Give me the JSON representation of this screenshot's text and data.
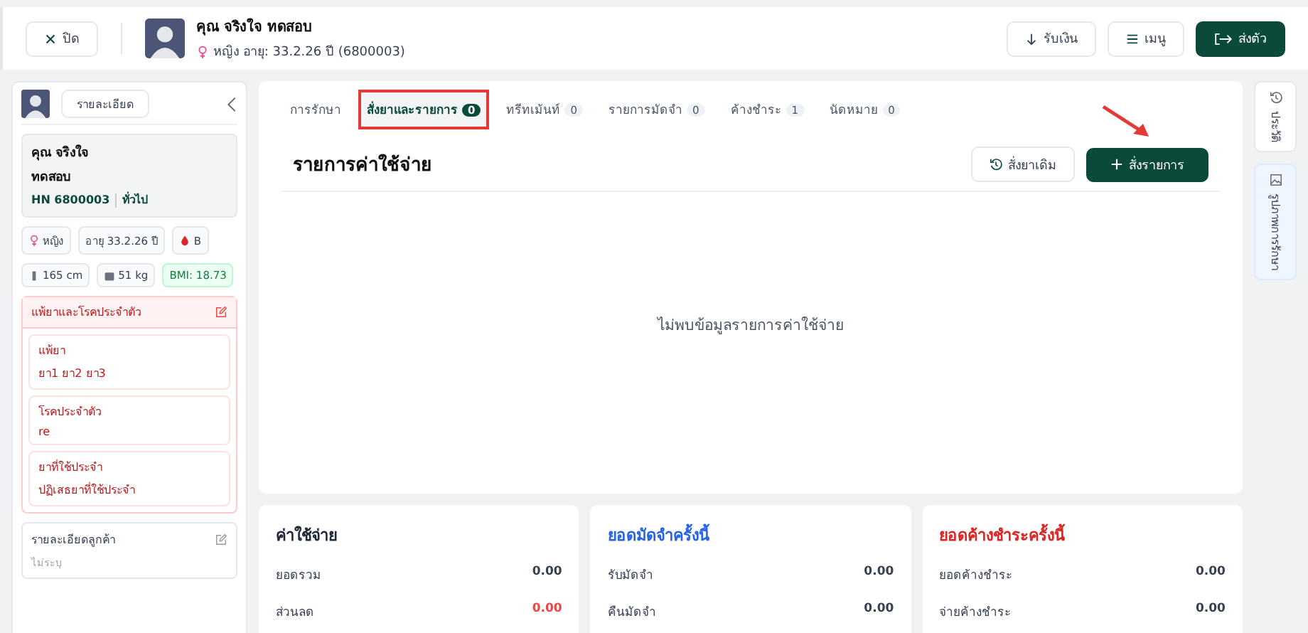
{
  "header": {
    "close_button": "ปิด",
    "patient_name": "คุณ จริงใจ ทดสอบ",
    "patient_meta": "หญิง  อายุ: 33.2.26 ปี  (6800003)",
    "buttons": [
      {
        "kind": "receive",
        "label": "รับเงิน"
      },
      {
        "kind": "menu",
        "label": "เมนู"
      },
      {
        "kind": "send",
        "label": "ส่งตัว"
      }
    ]
  },
  "sidebar": {
    "details_button": "รายละเอียด",
    "name_line1": "คุณ จริงใจ",
    "name_line2": "ทดสอบ",
    "hn": "HN 6800003",
    "group": "ทั่วไป",
    "chips": [
      {
        "kind": "gender",
        "label": "หญิง"
      },
      {
        "kind": "plain",
        "label": "อายุ 33.2.26 ปี"
      },
      {
        "kind": "blood",
        "label": "B"
      }
    ],
    "chips2": [
      {
        "kind": "height",
        "label": "165 cm"
      },
      {
        "kind": "weight",
        "label": "51 kg"
      },
      {
        "kind": "bmi",
        "label": "BMI: 18.73"
      }
    ],
    "allergy_title": "แพ้ยาและโรคประจำตัว",
    "allergy_items": [
      {
        "title": "แพ้ยา",
        "value": "ยา1 ยา2 ยา3"
      },
      {
        "title": "โรคประจำตัว",
        "value": "re"
      },
      {
        "title": "ยาที่ใช้ประจำ",
        "value": "ปฏิเสธยาที่ใช้ประจำ"
      }
    ],
    "customer_title": "รายละเอียดลูกค้า",
    "customer_value": "ไม่ระบุ"
  },
  "tabs": [
    {
      "label": "การรักษา",
      "selected": false,
      "highlighted": false
    },
    {
      "label": "สั่งยาและรายการ",
      "count": "0",
      "selected": true,
      "highlighted": true
    },
    {
      "label": "ทรีทเม้นท์",
      "count": "0",
      "selected": false,
      "highlighted": false
    },
    {
      "label": "รายการมัดจำ",
      "count": "0",
      "selected": false,
      "highlighted": false
    },
    {
      "label": "ค้างชำระ",
      "count": "1",
      "selected": false,
      "highlighted": false
    },
    {
      "label": "นัดหมาย",
      "count": "0",
      "selected": false,
      "highlighted": false
    }
  ],
  "section_title": "รายการค่าใช้จ่าย",
  "reorder_button": "สั่งยาเดิม",
  "add_button": "สั่งรายการ",
  "empty_message": "ไม่พบข้อมูลรายการค่าใช้จ่าย",
  "side_tabs": [
    {
      "kind": "history",
      "label": "ประวัติ"
    },
    {
      "kind": "gallery",
      "label": "รูปภาพการรักษา"
    }
  ],
  "summary_cards": [
    {
      "title": "ค่าใช้จ่าย",
      "kind": "dark",
      "rows": [
        {
          "label": "ยอดรวม",
          "value": "0.00",
          "negative": false
        },
        {
          "label": "ส่วนลด",
          "value": "0.00",
          "negative": true
        }
      ]
    },
    {
      "title": "ยอดมัดจำครั้งนี้",
      "kind": "blue",
      "rows": [
        {
          "label": "รับมัดจำ",
          "value": "0.00",
          "negative": false
        },
        {
          "label": "คืนมัดจำ",
          "value": "0.00",
          "negative": false
        }
      ]
    },
    {
      "title": "ยอดค้างชำระครั้งนี้",
      "kind": "red",
      "rows": [
        {
          "label": "ยอดค้างชำระ",
          "value": "0.00",
          "negative": false
        },
        {
          "label": "จ่ายค้างชำระ",
          "value": "0.00",
          "negative": false
        }
      ]
    }
  ]
}
